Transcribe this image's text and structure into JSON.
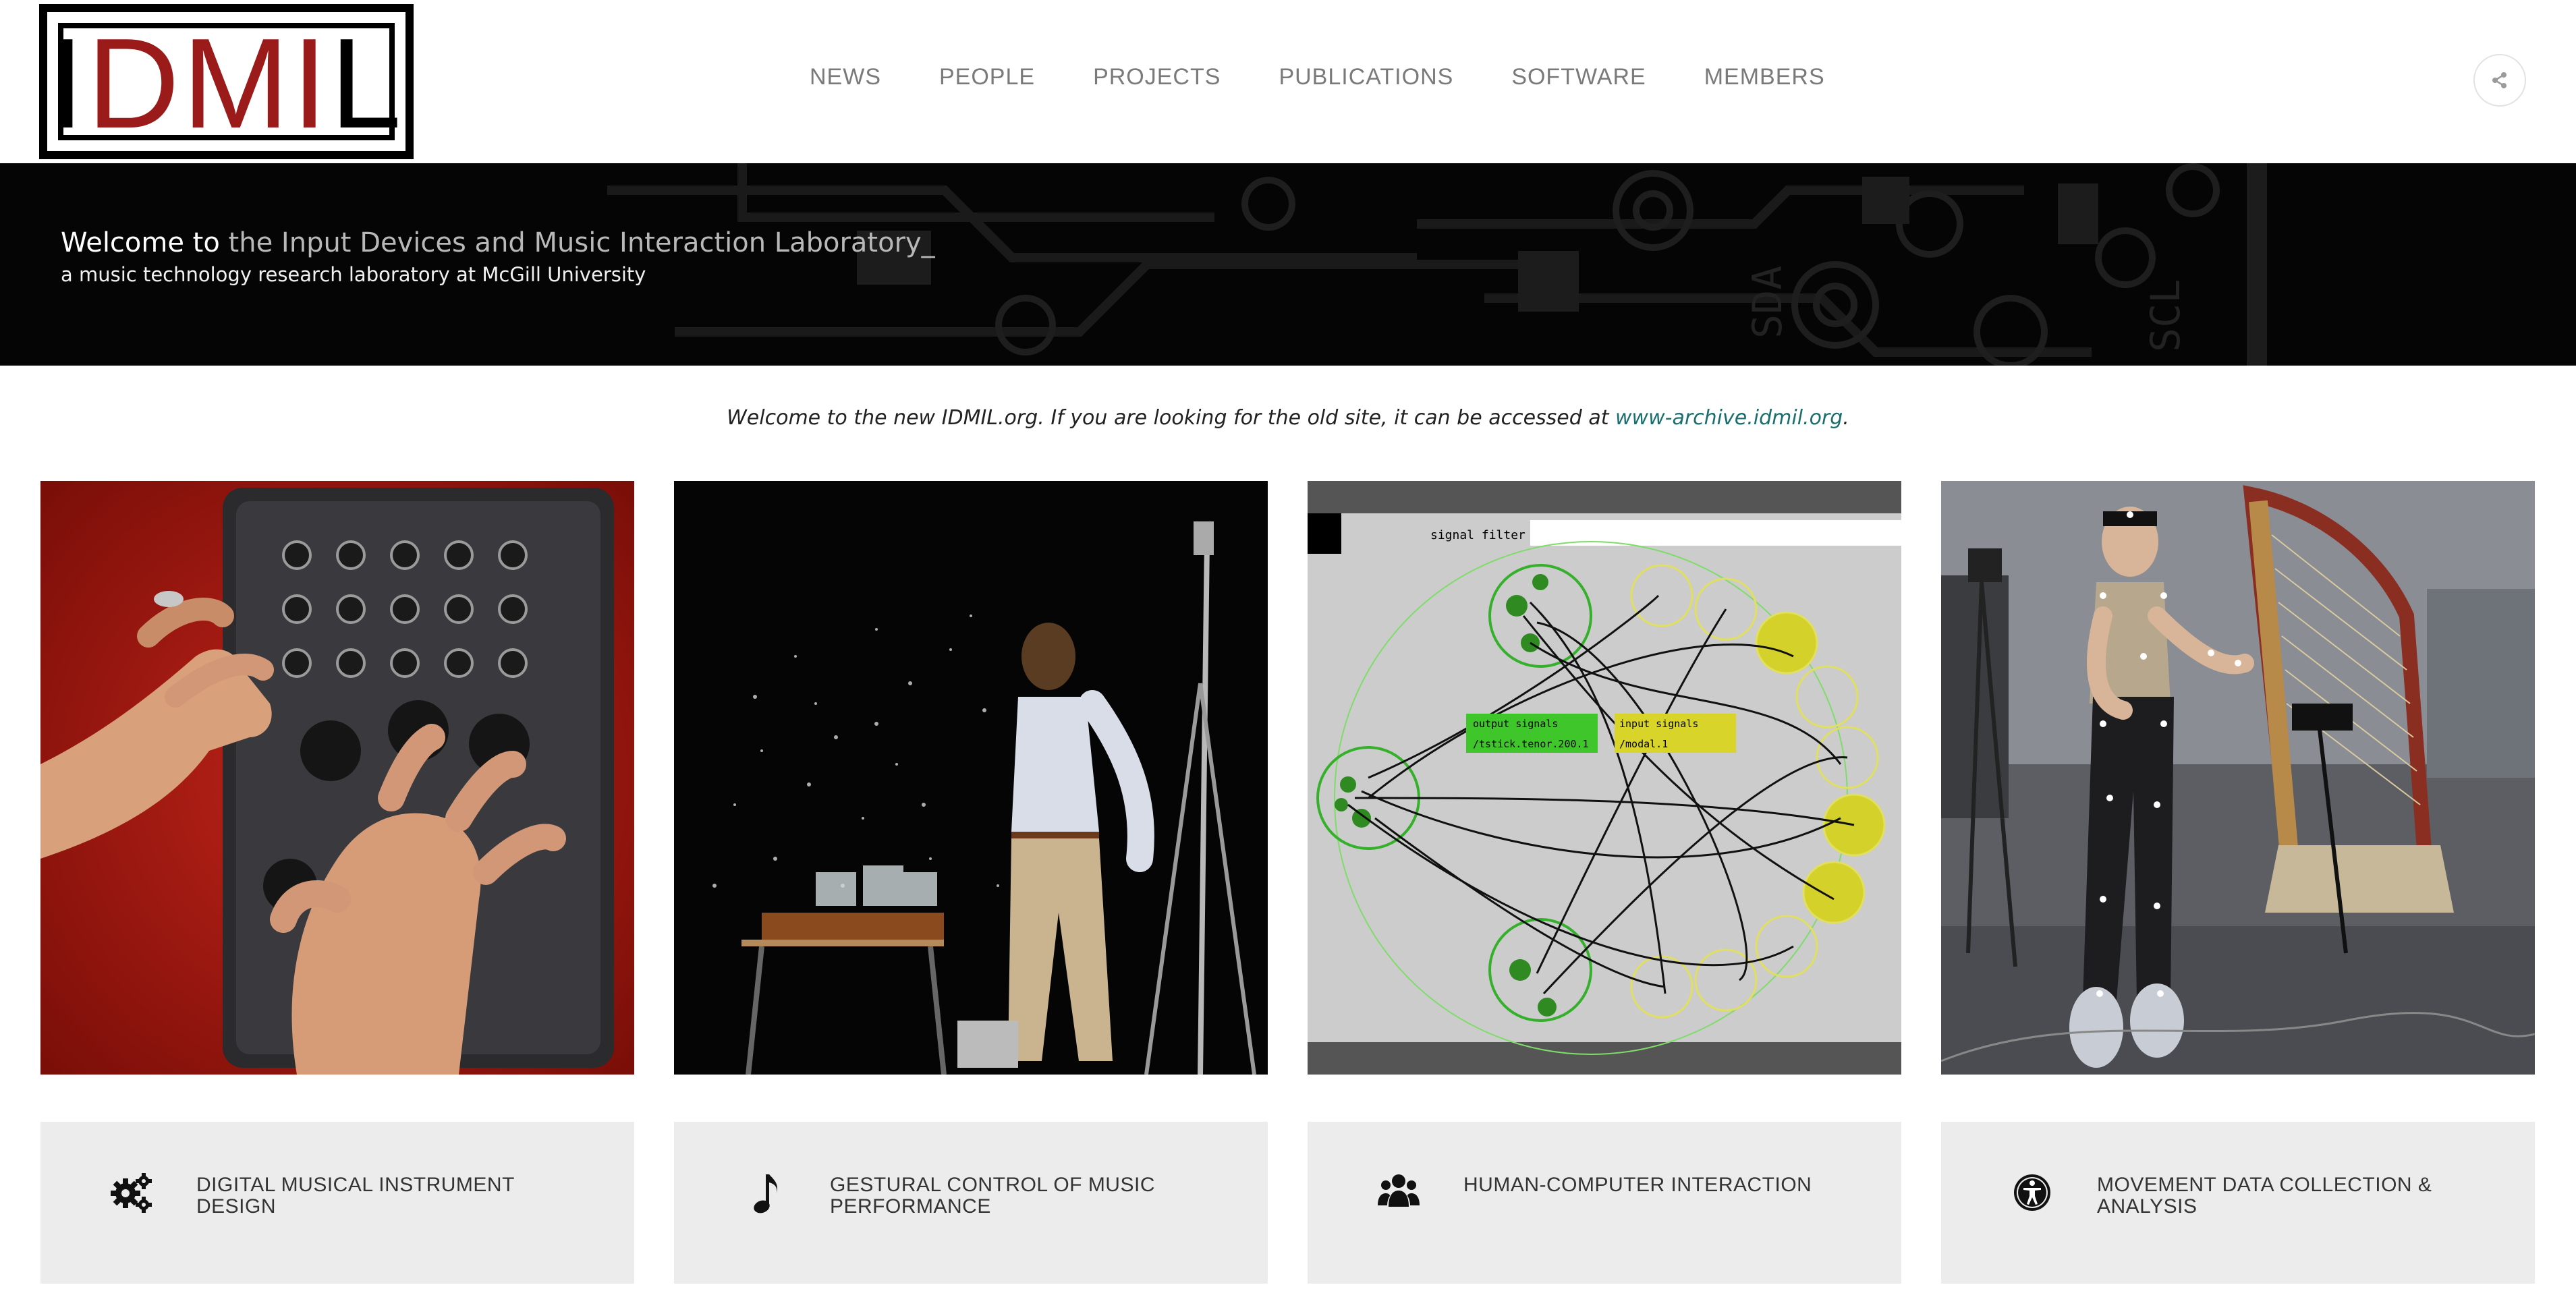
{
  "logo": {
    "text_black_1": "I",
    "text_red": "DMI",
    "text_black_2": "L"
  },
  "nav": {
    "items": [
      {
        "label": "NEWS"
      },
      {
        "label": "PEOPLE"
      },
      {
        "label": "PROJECTS"
      },
      {
        "label": "PUBLICATIONS"
      },
      {
        "label": "SOFTWARE"
      },
      {
        "label": "MEMBERS"
      }
    ],
    "share_icon": "share-icon"
  },
  "hero": {
    "welcome": "Welcome to",
    "lab_name": " the Input Devices and Music Interaction Laboratory_",
    "subtitle": "a music technology research laboratory at McGill University"
  },
  "notice": {
    "text": "Welcome to the new IDMIL.org. If you are looking for the old site, it can be accessed at ",
    "link": "www-archive.idmil.org",
    "suffix": "."
  },
  "patch": {
    "title": "signal filter",
    "output_label": "output signals",
    "output_value": "/tstick.tenor.200.1",
    "input_label": "input signals",
    "input_value": "/modal.1"
  },
  "cards": [
    {
      "label": "DIGITAL MUSICAL INSTRUMENT DESIGN",
      "icon": "gears-icon"
    },
    {
      "label": "GESTURAL CONTROL OF MUSIC PERFORMANCE",
      "icon": "music-note-icon"
    },
    {
      "label": "HUMAN-COMPUTER INTERACTION",
      "icon": "users-icon"
    },
    {
      "label": "MOVEMENT DATA COLLECTION & ANALYSIS",
      "icon": "accessibility-icon"
    }
  ],
  "colors": {
    "logo_red": "#9b1b1b",
    "link": "#1b6e6e",
    "card_bg": "#ececec",
    "hero_bg": "#000000"
  }
}
